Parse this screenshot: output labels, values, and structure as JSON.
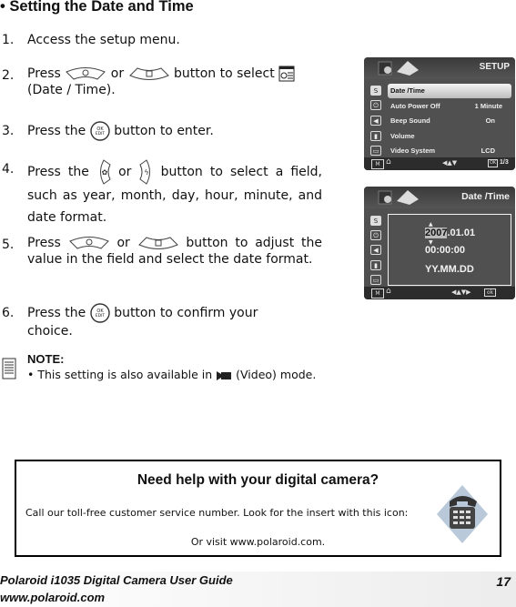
{
  "section_title": "• Setting the Date and Time",
  "steps": [
    {
      "num": "1.",
      "text": "Access the setup menu."
    },
    {
      "num": "2.",
      "pre": "Press",
      "or": "or",
      "post": "button to select",
      "tail": "(Date / Time)."
    },
    {
      "num": "3.",
      "pre": "Press the",
      "post": "button to enter."
    },
    {
      "num": "4.",
      "pre": "Press the",
      "or": "or",
      "post": "button to select a field,",
      "tail": "such as year, month, day, hour, minute, and date format."
    },
    {
      "num": "5.",
      "pre": "Press",
      "or": "or",
      "post": "button to adjust the",
      "tail": "value in the field and select the date format."
    },
    {
      "num": "6.",
      "pre": "Press the",
      "post": "button to confirm your",
      "tail": "choice."
    }
  ],
  "ok_button_label": {
    "top": "OK",
    "bottom": "EDIT"
  },
  "setup_screen": {
    "title": "SETUP",
    "items": [
      {
        "label": "Date /Time",
        "value": "",
        "icon": "S",
        "selected": true
      },
      {
        "label": "Auto Power Off",
        "value": "1 Minute",
        "icon": "⏻"
      },
      {
        "label": "Beep Sound",
        "value": "On",
        "icon": "◀"
      },
      {
        "label": "Volume",
        "value": "",
        "icon": "▮"
      },
      {
        "label": "Video System",
        "value": "LCD",
        "icon": "▭"
      }
    ],
    "footer_left": "M",
    "footer_arrows": "◀▲▼",
    "footer_ok": "OK",
    "page": "1/3"
  },
  "date_screen": {
    "title": "Date /Time",
    "year": "2007",
    "date_rest": ".01.01",
    "time": "00:00:00",
    "format": "YY.MM.DD",
    "footer_left": "M",
    "footer_arrows": "◀▲▼▶",
    "footer_ok": "ok"
  },
  "note": {
    "title": "NOTE:",
    "pre": "•  This setting is also available in",
    "post": "(Video) mode."
  },
  "help_box": {
    "title": "Need help with your digital camera?",
    "line": "Call our toll-free customer service number. Look for the insert with this icon:",
    "visit": "Or visit www.polaroid.com."
  },
  "footer": {
    "guide": "Polaroid i1035 Digital Camera User Guide",
    "url": "www.polaroid.com",
    "page_number": "17"
  }
}
